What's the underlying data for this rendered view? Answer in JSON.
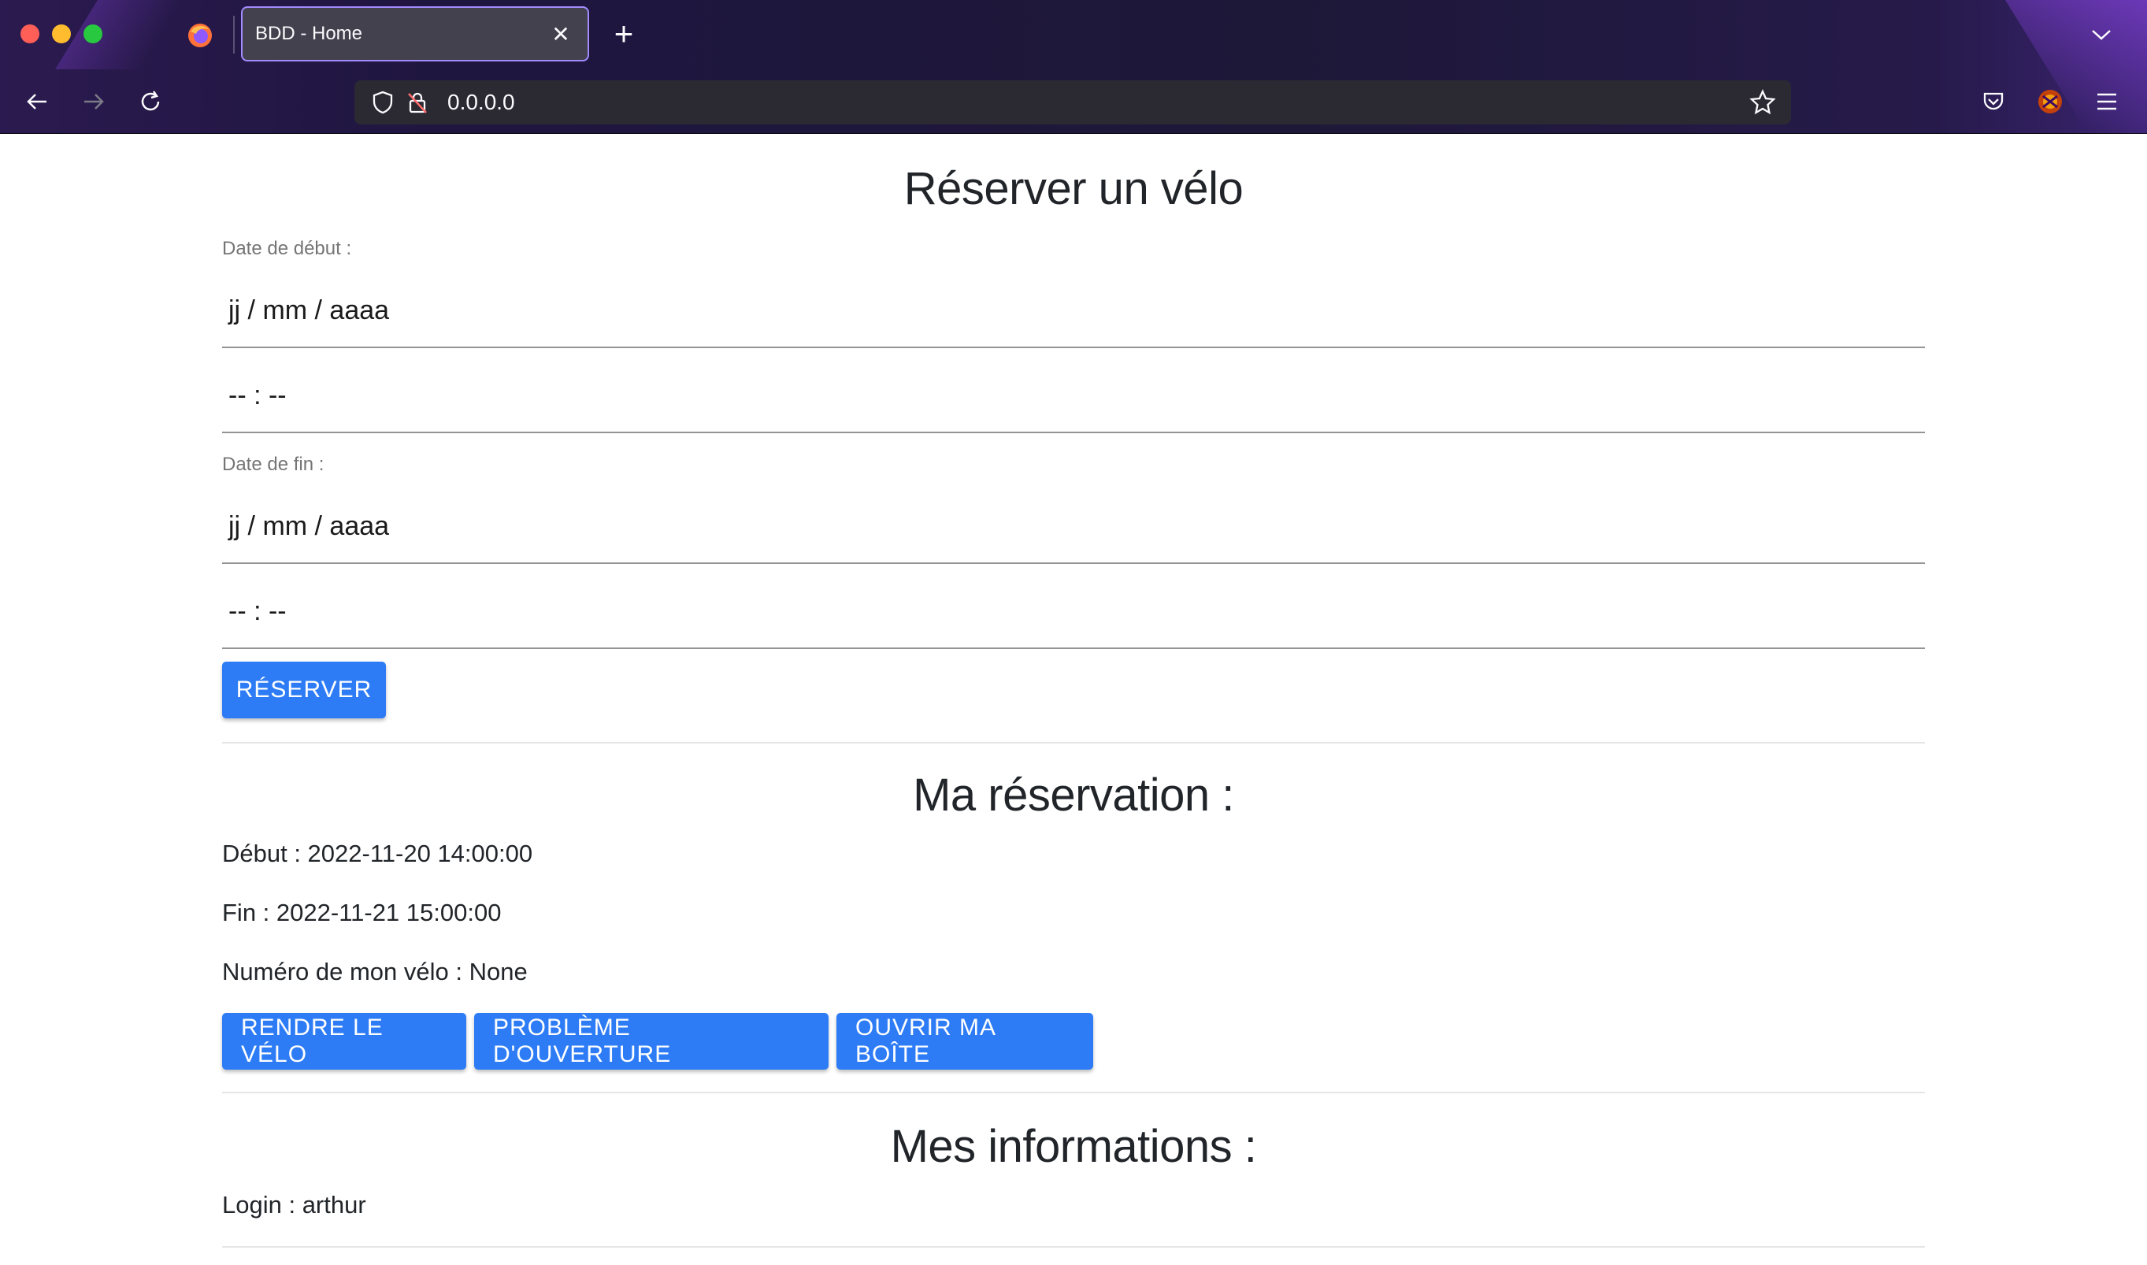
{
  "browser": {
    "tab_title": "BDD - Home",
    "tab_close_icon": "close-icon",
    "new_tab_label": "+",
    "url": "0.0.0.0",
    "colors": {
      "tab_border": "#a38bff",
      "chrome_bg": "#1f1640",
      "urlbar_bg": "#2b2a33"
    }
  },
  "reserve": {
    "title": "Réserver un vélo",
    "start_label": "Date de début :",
    "start_date_placeholder": "jj / mm / aaaa",
    "start_time_placeholder": "-- : --",
    "end_label": "Date de fin :",
    "end_date_placeholder": "jj / mm / aaaa",
    "end_time_placeholder": "-- : --",
    "submit_label": "Réserver"
  },
  "reservation": {
    "title": "Ma réservation :",
    "start": "Début : 2022-11-20 14:00:00",
    "end": "Fin : 2022-11-21 15:00:00",
    "bike_number": "Numéro de mon vélo : None",
    "return_label": "Rendre le vélo",
    "problem_label": "Problème d'ouverture",
    "open_box_label": "Ouvrir ma boîte"
  },
  "info": {
    "title": "Mes informations :",
    "login": "Login : arthur"
  },
  "colors": {
    "primary_button": "#2d7cf6",
    "text": "#212529",
    "label": "#757575"
  }
}
